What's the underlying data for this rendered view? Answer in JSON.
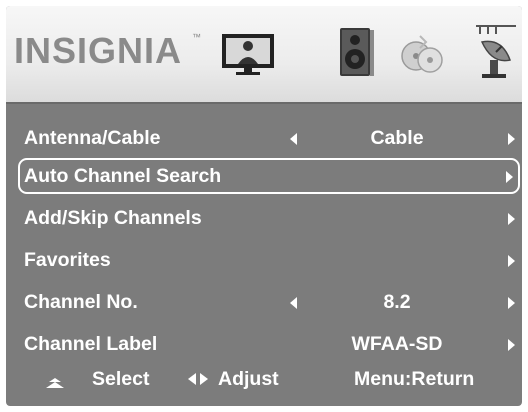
{
  "brand": {
    "logo_text": "INSIGNIA",
    "trademark": "™"
  },
  "tabs": [
    {
      "icon": "tv-picture-icon",
      "label": ""
    },
    {
      "icon": "speaker-audio-icon",
      "label": ""
    },
    {
      "icon": "discs-settings-icon",
      "label": ""
    },
    {
      "icon": "satellite-antenna-icon",
      "label": ""
    }
  ],
  "menu": {
    "items": [
      {
        "label": "Antenna/Cable",
        "value": "Cable",
        "has_left_arrow": true,
        "has_right_arrow": true
      },
      {
        "label": "Auto Channel Search",
        "value": "",
        "has_left_arrow": false,
        "has_right_arrow": true,
        "selected": true
      },
      {
        "label": "Add/Skip Channels",
        "value": "",
        "has_left_arrow": false,
        "has_right_arrow": true
      },
      {
        "label": "Favorites",
        "value": "",
        "has_left_arrow": false,
        "has_right_arrow": true
      },
      {
        "label": "Channel No.",
        "value": "8.2",
        "has_left_arrow": true,
        "has_right_arrow": true
      },
      {
        "label": "Channel Label",
        "value": "WFAA-SD",
        "has_left_arrow": false,
        "has_right_arrow": true
      }
    ]
  },
  "footer": {
    "select_label": "Select",
    "adjust_label": "Adjust",
    "return_label": "Menu:Return"
  },
  "colors": {
    "panel": "#7c7c7c",
    "header": "#ececec",
    "text": "#ffffff",
    "logo": "#8a8a8a"
  }
}
